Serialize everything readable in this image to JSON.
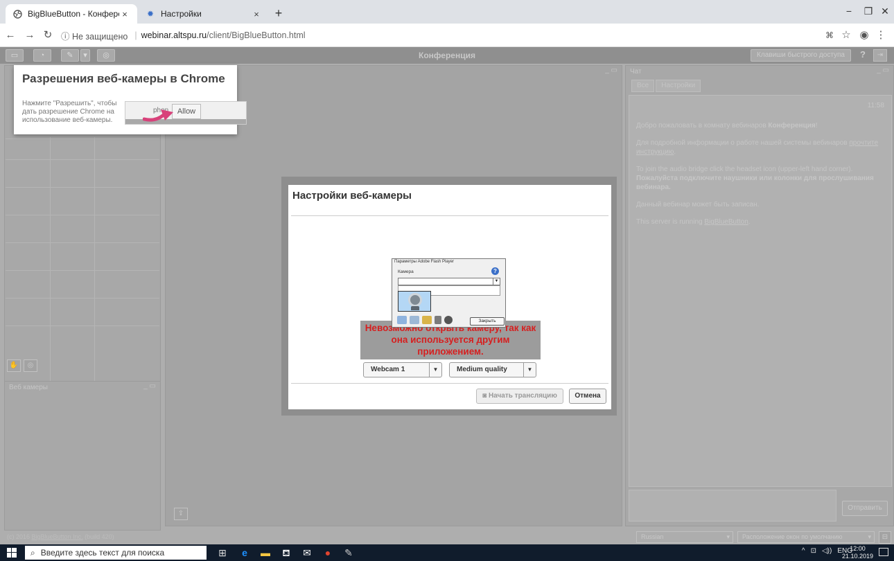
{
  "browser": {
    "tabs": [
      {
        "title": "BigBlueButton - Конференция",
        "icon": "globe-icon",
        "active": true
      },
      {
        "title": "Настройки",
        "icon": "gear-icon",
        "active": false
      }
    ],
    "new_tab": "+",
    "address": {
      "security": "ⓘ Не защищено",
      "separator": "|",
      "host": "webinar.altspu.ru",
      "path": "/client/BigBlueButton.html"
    }
  },
  "app": {
    "title": "Конференция",
    "hotkeys_label": "Клавиши быстрого доступа",
    "help_label": "?",
    "webcams_panel": "Веб камеры",
    "chat": {
      "panel_title": "Чат",
      "tabs": [
        "Все",
        "Настройки"
      ],
      "time": "11:58",
      "messages": [
        {
          "text": "Добро пожаловать в комнату вебинаров ",
          "bold": "Конференция",
          "tail": "!"
        },
        {
          "text": "Для подробной информации о работе нашей системы вебинаров ",
          "link": "прочтите инструкцию",
          "tail": "."
        },
        {
          "text": "To join the audio bridge click the headset icon (upper-left hand corner). ",
          "bold": "Пожалуйста подключите наушники или колонки для прослушивания вебинара.",
          "tail": ""
        },
        {
          "text": "Данный вебинар может быть записан.",
          "bold": "",
          "tail": ""
        },
        {
          "text": "This server is running ",
          "link": "BigBlueButton",
          "tail": "."
        }
      ],
      "send_label": "Отправить"
    },
    "footer": {
      "prefix": "(c) 2016 ",
      "link": "BigBlueButton Inc.",
      "suffix": " (build 420)"
    },
    "language": "Russian",
    "layout": "Расположение окон по умолчанию"
  },
  "permission_popup": {
    "title": "Разрешения веб-камеры в Chrome",
    "text": "Нажмите \"Разрешить\", чтобы дать разрешение Chrome на использование веб-камеры.",
    "partial_label": "phon",
    "allow_label": "Allow"
  },
  "webcam_modal": {
    "title": "Настройки веб-камеры",
    "error": "Невозможно открыть камеру, так как она используется другим приложением.",
    "camera_select": "Webcam 1",
    "quality_select": "Medium quality",
    "start_label": "Начать трансляцию",
    "cancel_label": "Отмена"
  },
  "flash_settings": {
    "title": "Параметры Adobe Flash Player",
    "section": "Камера",
    "close_label": "Закрыть"
  },
  "taskbar": {
    "search_placeholder": "Введите здесь текст для поиска",
    "lang": "ENG",
    "time": "12:00",
    "date": "21.10.2019"
  }
}
